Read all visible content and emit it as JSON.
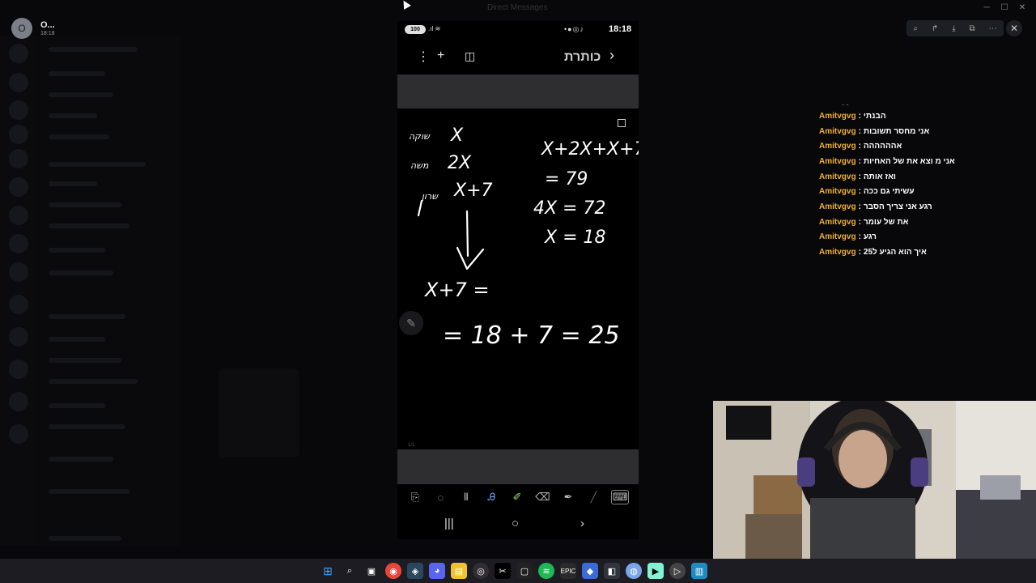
{
  "viewer": {
    "user_initial": "O",
    "user_name": "O...",
    "time": "18:18",
    "window_title": "Direct Messages"
  },
  "phone": {
    "battery": "100",
    "clock": "18:18",
    "note_title": "כותרת",
    "page_indicator": "1/1",
    "handwriting": {
      "left_labels": [
        "שוקה",
        "משה",
        "שרון"
      ],
      "left_values": [
        "X",
        "2X",
        "X+7"
      ],
      "right_lines": [
        "X+2X+X+7",
        "= 79",
        "4X = 72",
        "X = 18"
      ],
      "expression": "X+7 =",
      "result": "= 18 + 7 = 25"
    }
  },
  "chat": {
    "messages": [
      {
        "user": "Amitvgvg",
        "text": "הבנתי"
      },
      {
        "user": "Amitvgvg",
        "text": "אני מחסר תשובות"
      },
      {
        "user": "Amitvgvg",
        "text": "אהההההה"
      },
      {
        "user": "Amitvgvg",
        "text": "אני מ וצא את של האחיות"
      },
      {
        "user": "Amitvgvg",
        "text": "ואז אותה"
      },
      {
        "user": "Amitvgvg",
        "text": "עשיתי גם ככה"
      },
      {
        "user": "Amitvgvg",
        "text": "רגע אני צריך הסבר"
      },
      {
        "user": "Amitvgvg",
        "text": "את של עומר"
      },
      {
        "user": "Amitvgvg",
        "text": "רגע"
      },
      {
        "user": "Amitvgvg",
        "text": "איך הוא הגיע ל25"
      }
    ]
  },
  "colors": {
    "chat_username": "#f0b12e",
    "taskbar": "#1c1c22",
    "phone_panel_gray": "#2e2e30"
  },
  "taskbar": {
    "icons": [
      "windows-start-icon",
      "search-icon",
      "task-view-icon",
      "chrome-icon",
      "steam-icon",
      "discord-icon",
      "file-explorer-icon",
      "obs-icon",
      "capcut-icon",
      "app-icon",
      "spotify-icon",
      "epic-games-icon",
      "app-icon-2",
      "app-icon-3",
      "app-icon-4",
      "streamlabs-icon",
      "media-player-icon",
      "app-icon-5"
    ]
  }
}
